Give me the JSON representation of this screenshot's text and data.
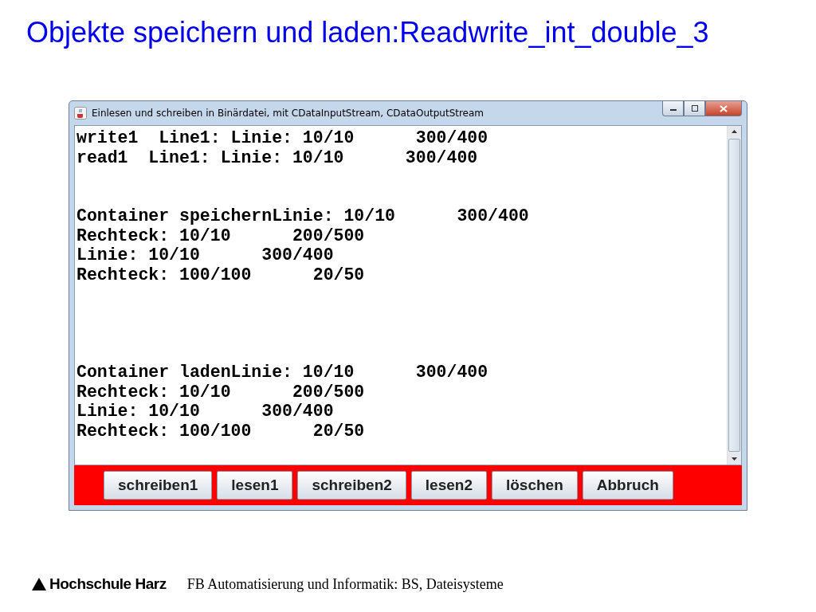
{
  "slide_title": "Objekte speichern und laden:Readwrite_int_double_3",
  "window": {
    "title": "Einlesen und schreiben in Binärdatei, mit CDataInputStream, CDataOutputStream",
    "output": "write1  Line1: Linie: 10/10      300/400\nread1  Line1: Linie: 10/10      300/400\n\n\nContainer speichernLinie: 10/10      300/400\nRechteck: 10/10      200/500\nLinie: 10/10      300/400\nRechteck: 100/100      20/50\n\n\n\n\nContainer ladenLinie: 10/10      300/400\nRechteck: 10/10      200/500\nLinie: 10/10      300/400\nRechteck: 100/100      20/50",
    "buttons": [
      "schreiben1",
      "lesen1",
      "schreiben2",
      "lesen2",
      "löschen",
      "Abbruch"
    ]
  },
  "footer": {
    "institution": "Hochschule Harz",
    "text": "FB Automatisierung und Informatik: BS, Dateisysteme"
  }
}
